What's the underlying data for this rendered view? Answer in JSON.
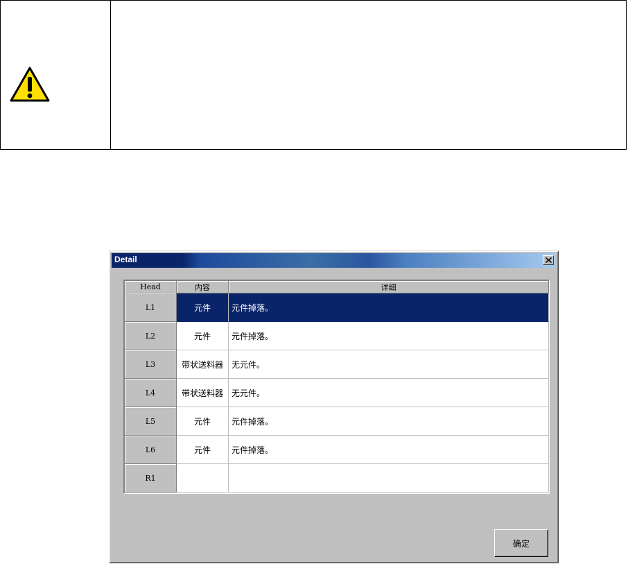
{
  "dialog": {
    "title": "Detail",
    "ok_label": "确定",
    "columns": [
      "Head",
      "内容",
      "详细"
    ],
    "rows": [
      {
        "head": "L1",
        "content": "元件",
        "detail": "元件掉落。",
        "selected": true
      },
      {
        "head": "L2",
        "content": "元件",
        "detail": "元件掉落。",
        "selected": false
      },
      {
        "head": "L3",
        "content": "带状送料器",
        "detail": "无元件。",
        "selected": false
      },
      {
        "head": "L4",
        "content": "带状送料器",
        "detail": "无元件。",
        "selected": false
      },
      {
        "head": "L5",
        "content": "元件",
        "detail": "元件掉落。",
        "selected": false
      },
      {
        "head": "L6",
        "content": "元件",
        "detail": "元件掉落。",
        "selected": false
      },
      {
        "head": "R1",
        "content": "",
        "detail": "",
        "selected": false
      }
    ]
  },
  "colors": {
    "selection": "#0a246a",
    "dialog_face": "#c0c0c0",
    "warning_fill": "#ffe000"
  },
  "icons": {
    "warning": "warning-triangle-icon",
    "close": "close-icon"
  }
}
